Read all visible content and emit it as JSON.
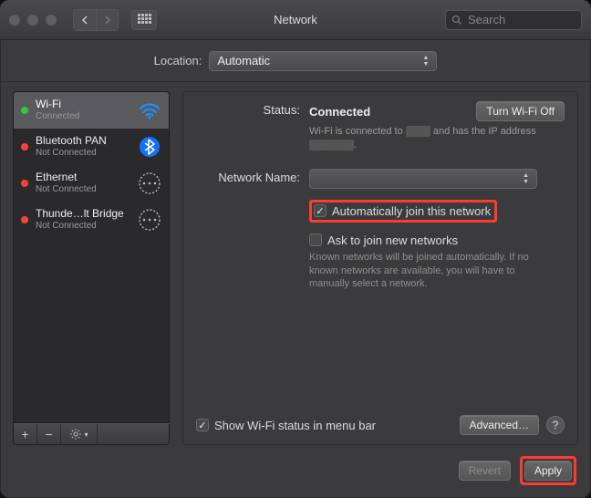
{
  "window": {
    "title": "Network"
  },
  "search": {
    "placeholder": "Search"
  },
  "location": {
    "label": "Location:",
    "value": "Automatic"
  },
  "sidebar": {
    "items": [
      {
        "name": "Wi-Fi",
        "status": "Connected",
        "dot": "green"
      },
      {
        "name": "Bluetooth PAN",
        "status": "Not Connected",
        "dot": "red"
      },
      {
        "name": "Ethernet",
        "status": "Not Connected",
        "dot": "red"
      },
      {
        "name": "Thunde…lt Bridge",
        "status": "Not Connected",
        "dot": "red"
      }
    ]
  },
  "detail": {
    "status_label": "Status:",
    "status_value": "Connected",
    "wifi_off_label": "Turn Wi-Fi Off",
    "status_sub_prefix": "Wi-Fi is connected to",
    "status_sub_mid": "and has the IP address",
    "network_name_label": "Network Name:",
    "network_name_value": "",
    "auto_join_label": "Automatically join this network",
    "auto_join_checked": true,
    "ask_join_label": "Ask to join new networks",
    "ask_join_checked": false,
    "ask_join_help": "Known networks will be joined automatically. If no known networks are available, you will have to manually select a network.",
    "show_menubar_label": "Show Wi-Fi status in menu bar",
    "show_menubar_checked": true,
    "advanced_label": "Advanced…"
  },
  "footer": {
    "revert": "Revert",
    "apply": "Apply"
  }
}
